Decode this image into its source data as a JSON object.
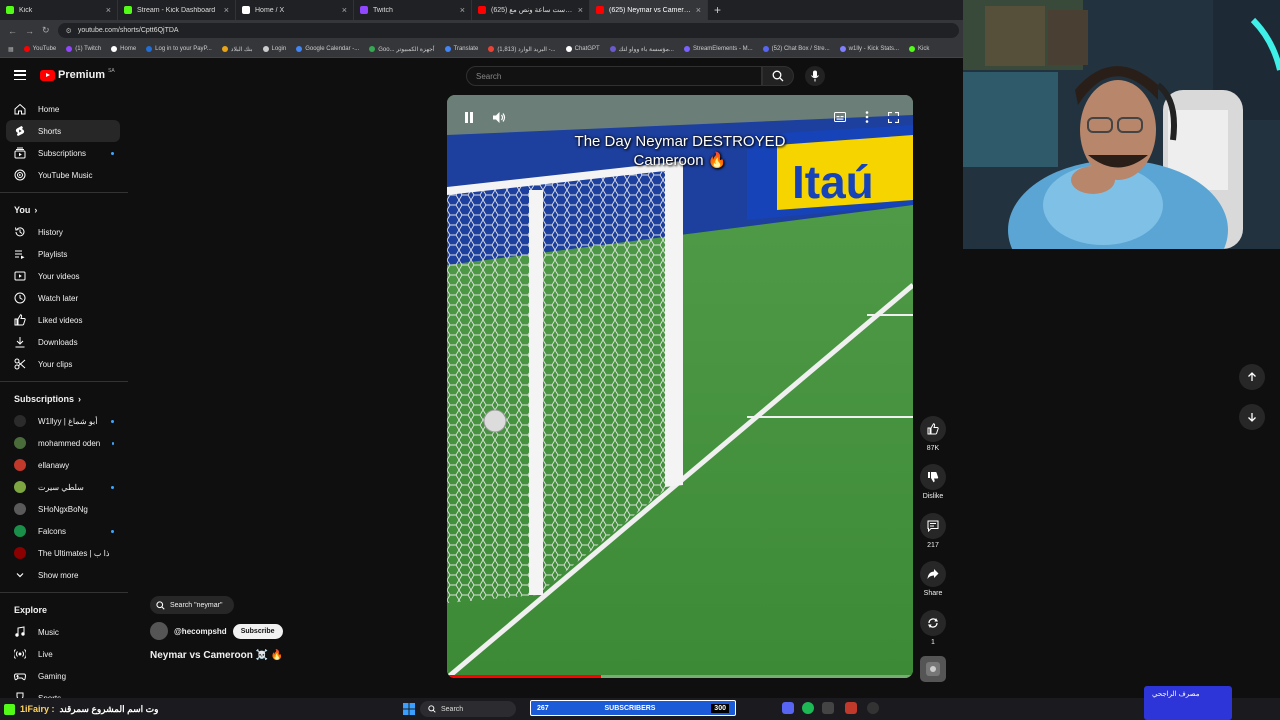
{
  "browser": {
    "tabs": [
      {
        "label": "Kick",
        "color": "#53fc18"
      },
      {
        "label": "Stream - Kick Dashboard",
        "color": "#53fc18"
      },
      {
        "label": "Home / X",
        "color": "#ffffff"
      },
      {
        "label": "Twitch",
        "color": "#9146ff"
      },
      {
        "label": "(625) بودكاست ساعة ونص مع ..",
        "color": "#ff0000"
      },
      {
        "label": "(625) Neymar vs Cameroon",
        "color": "#ff0000"
      }
    ],
    "url": "youtube.com/shorts/Cptt6QjTDA",
    "bookmarks": [
      {
        "label": "YouTube",
        "color": "#ff0000"
      },
      {
        "label": "(1) Twitch",
        "color": "#9146ff"
      },
      {
        "label": "Home",
        "color": "#ffffff"
      },
      {
        "label": "Log in to your PayP...",
        "color": "#1f6fd6"
      },
      {
        "label": "بنك البلاد",
        "color": "#e8a317"
      },
      {
        "label": "Login",
        "color": "#cccccc"
      },
      {
        "label": "Google Calendar -...",
        "color": "#4285f4"
      },
      {
        "label": "Goo... أجهزة الكمبيوتر",
        "color": "#34a853"
      },
      {
        "label": "Translate",
        "color": "#4285f4"
      },
      {
        "label": "(1,813) البريد الوارد -...",
        "color": "#ea4335"
      },
      {
        "label": "ChatGPT",
        "color": "#ffffff"
      },
      {
        "label": "مؤسسة باء وواو لتك...",
        "color": "#6a5acd"
      },
      {
        "label": "StreamElements - M...",
        "color": "#7b61ff"
      },
      {
        "label": "(52) Chat Box / Stre...",
        "color": "#5865f2"
      },
      {
        "label": "w1lly - Kick Stats...",
        "color": "#7f7fff"
      },
      {
        "label": "Kick",
        "color": "#53fc18"
      }
    ]
  },
  "youtube": {
    "logo_text": "Premium",
    "country_code": "SA",
    "search_placeholder": "Search",
    "sidebar": {
      "main": [
        {
          "label": "Home",
          "icon": "home-icon"
        },
        {
          "label": "Shorts",
          "icon": "shorts-icon"
        },
        {
          "label": "Subscriptions",
          "icon": "subscriptions-icon"
        },
        {
          "label": "YouTube Music",
          "icon": "music-icon"
        }
      ],
      "you_title": "You",
      "you": [
        {
          "label": "History",
          "icon": "history-icon"
        },
        {
          "label": "Playlists",
          "icon": "playlists-icon"
        },
        {
          "label": "Your videos",
          "icon": "your-videos-icon"
        },
        {
          "label": "Watch later",
          "icon": "clock-icon"
        },
        {
          "label": "Liked videos",
          "icon": "like-icon"
        },
        {
          "label": "Downloads",
          "icon": "download-icon"
        },
        {
          "label": "Your clips",
          "icon": "scissors-icon"
        }
      ],
      "subscriptions_title": "Subscriptions",
      "subscriptions": [
        {
          "label": "W1llyy | أبو شماغ",
          "color": "#2b2b2b",
          "dot": true
        },
        {
          "label": "mohammed oden",
          "color": "#4a6b3a",
          "dot": true
        },
        {
          "label": "ellanawy",
          "color": "#c0392b",
          "dot": false
        },
        {
          "label": "سلطي سيرت",
          "color": "#7da640",
          "dot": true
        },
        {
          "label": "SHoNgxBoNg",
          "color": "#5a5a5a",
          "dot": false
        },
        {
          "label": "Falcons",
          "color": "#1a8f4a",
          "dot": true
        },
        {
          "label": "The Ultimates | ذا ب",
          "color": "#8b0000",
          "dot": false
        }
      ],
      "show_more": "Show more",
      "explore_title": "Explore",
      "explore": [
        {
          "label": "Music",
          "icon": "music-note-icon"
        },
        {
          "label": "Live",
          "icon": "live-icon"
        },
        {
          "label": "Gaming",
          "icon": "gaming-icon"
        },
        {
          "label": "Sports",
          "icon": "sports-icon"
        }
      ]
    },
    "short": {
      "overlay_title_line1": "The Day Neymar DESTROYED",
      "overlay_title_line2": "Cameroon 🔥",
      "progress": 0.33,
      "search_hint": "Search \"neymar\"",
      "channel": "@hecompshd",
      "subscribe_label": "Subscribe",
      "title": "Neymar vs Cameroon ☠️ 🔥",
      "like_count": "87K",
      "dislike_label": "Dislike",
      "comments_count": "217",
      "share_label": "Share",
      "remix_count": "1"
    }
  },
  "stream_overlay": {
    "chat_user": "1iFairy :",
    "chat_message": "وت اسم المشروع سمرقند",
    "task_search": "Search",
    "subs_current": "267",
    "subs_label": "SUBSCRIBERS",
    "subs_goal": "300",
    "sponsor": "مصرف الراجحي"
  }
}
